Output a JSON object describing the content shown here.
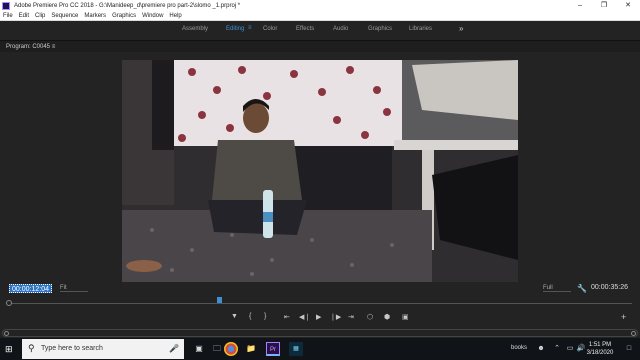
{
  "window": {
    "title": "Adobe Premiere Pro CC 2018 - G:\\Manideep_d\\premiere pro part-2\\slomo _1.prproj *",
    "controls": [
      "–",
      "❐",
      "✕"
    ]
  },
  "menu": [
    "File",
    "Edit",
    "Clip",
    "Sequence",
    "Markers",
    "Graphics",
    "Window",
    "Help"
  ],
  "workspaces": {
    "tabs": [
      "Assembly",
      "Editing",
      "Color",
      "Effects",
      "Audio",
      "Graphics",
      "Libraries"
    ],
    "active": "Editing",
    "active_menu_icon": "≡",
    "overflow": "»"
  },
  "program_monitor": {
    "title": "Program: C0045",
    "title_menu": "≡",
    "current_timecode": "00:00:12:04",
    "fit_label": "Fit",
    "quality_label": "Full",
    "duration_timecode": "00:00:35:26",
    "playhead_fraction": 0.34
  },
  "transport": {
    "marker": "▼",
    "mark_in": "{",
    "mark_out": "}",
    "go_to_in": "⇤",
    "step_back": "◀❘",
    "play": "▶",
    "step_forward": "❘▶",
    "go_to_out": "⇥",
    "lift": "⬡",
    "extract": "⬢",
    "export_frame": "▣",
    "add": "+"
  },
  "taskbar": {
    "search_placeholder": "Type here to search",
    "tray_label": "books",
    "time": "1:51 PM",
    "date": "3/18/2020",
    "apps": [
      "task-view",
      "file-explorer",
      "chrome",
      "folder",
      "premiere-pro",
      "media-encoder"
    ]
  },
  "colors": {
    "accent": "#3d8fd6",
    "panel_bg": "#232323",
    "taskbar_bg": "#101418",
    "premiere_icon": "#2a0f4a"
  }
}
